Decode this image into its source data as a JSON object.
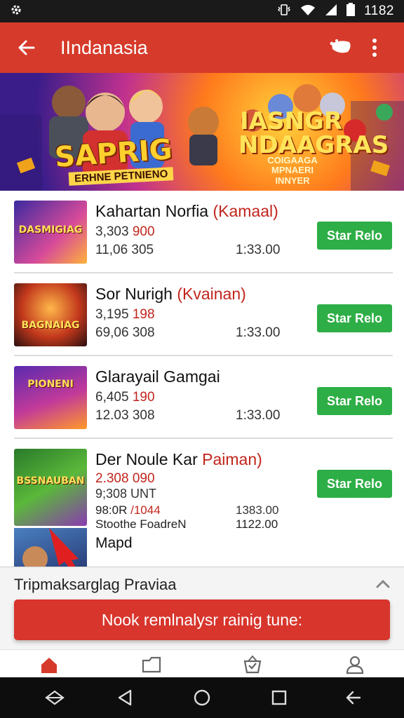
{
  "status_bar": {
    "time": "1182"
  },
  "app_bar": {
    "title": "IIndanasia"
  },
  "banner": {
    "left_title": "SAPRIG",
    "left_subtitle": "ERHNE PETNIENO",
    "right_title": "IASNGR NDAAGRAS",
    "right_subtitle": "COIGAAGA MPNAERI INNYER"
  },
  "games": [
    {
      "name": "Kahartan Norfia",
      "name_accent": "(Kamaal)",
      "thumb_text": "DASMIGIAG",
      "line1_a": "3,303",
      "line1_b": "900",
      "line2": "11,06 305",
      "line2_right": "1:33.00",
      "button": "Star Relo"
    },
    {
      "name": "Sor Nurigh",
      "name_accent": "(Kvainan)",
      "thumb_text": "BAGNAIAG",
      "line1_a": "3,195",
      "line1_b": "198",
      "line2": "69,06 308",
      "line2_right": "1:33.00",
      "button": "Star Relo"
    },
    {
      "name": "Glarayail Gamgai",
      "name_accent": "",
      "thumb_text": "PIONENI",
      "line1_a": "6,405",
      "line1_b": "190",
      "line2": "12.03 308",
      "line2_right": "1:33.00",
      "button": "Star Relo"
    },
    {
      "name": "Der Noule Kar",
      "name_accent": "Paiman)",
      "thumb_text": "BSSNAUBAN",
      "line1_a": "2.308 090",
      "line1_b": "",
      "line2": "9;308 UNT",
      "line3_a": "98:0R",
      "line3_b": "/1044",
      "line3_right": "1383.00",
      "line4": "Stoothe FoadreN",
      "line4_right": "1122.00",
      "button": "Star Relo"
    }
  ],
  "partial_item": {
    "name": "Mapd"
  },
  "sheet": {
    "heading": "Tripmaksarglag Praviaa",
    "cta": "Nook remlnalysr rainig tune:"
  },
  "tabs": [
    "home-icon",
    "folder-icon",
    "basket-icon",
    "profile-icon"
  ],
  "colors": {
    "app_bar": "#d63a2a",
    "accent_red": "#c1251c",
    "button_green": "#2eae46",
    "cta_red": "#d8352c"
  }
}
